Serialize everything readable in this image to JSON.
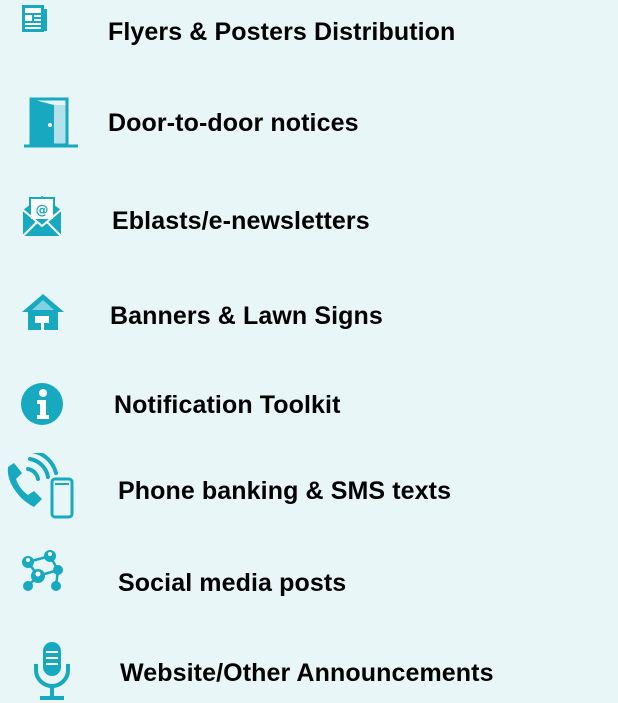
{
  "items": [
    {
      "label": "Flyers & Posters Distribution",
      "icon": "newspaper-icon"
    },
    {
      "label": "Door-to-door notices",
      "icon": "door-icon"
    },
    {
      "label": "Eblasts/e-newsletters",
      "icon": "email-envelope-icon"
    },
    {
      "label": "Banners & Lawn Signs",
      "icon": "house-sign-icon"
    },
    {
      "label": "Notification Toolkit",
      "icon": "info-icon"
    },
    {
      "label": "Phone banking & SMS texts",
      "icon": "phone-sms-icon"
    },
    {
      "label": "Social media posts",
      "icon": "social-network-icon"
    },
    {
      "label": "Website/Other Announcements",
      "icon": "microphone-icon"
    }
  ],
  "colors": {
    "background": "#e8f6f8",
    "icon": "#17a9c0",
    "text": "#000000"
  }
}
